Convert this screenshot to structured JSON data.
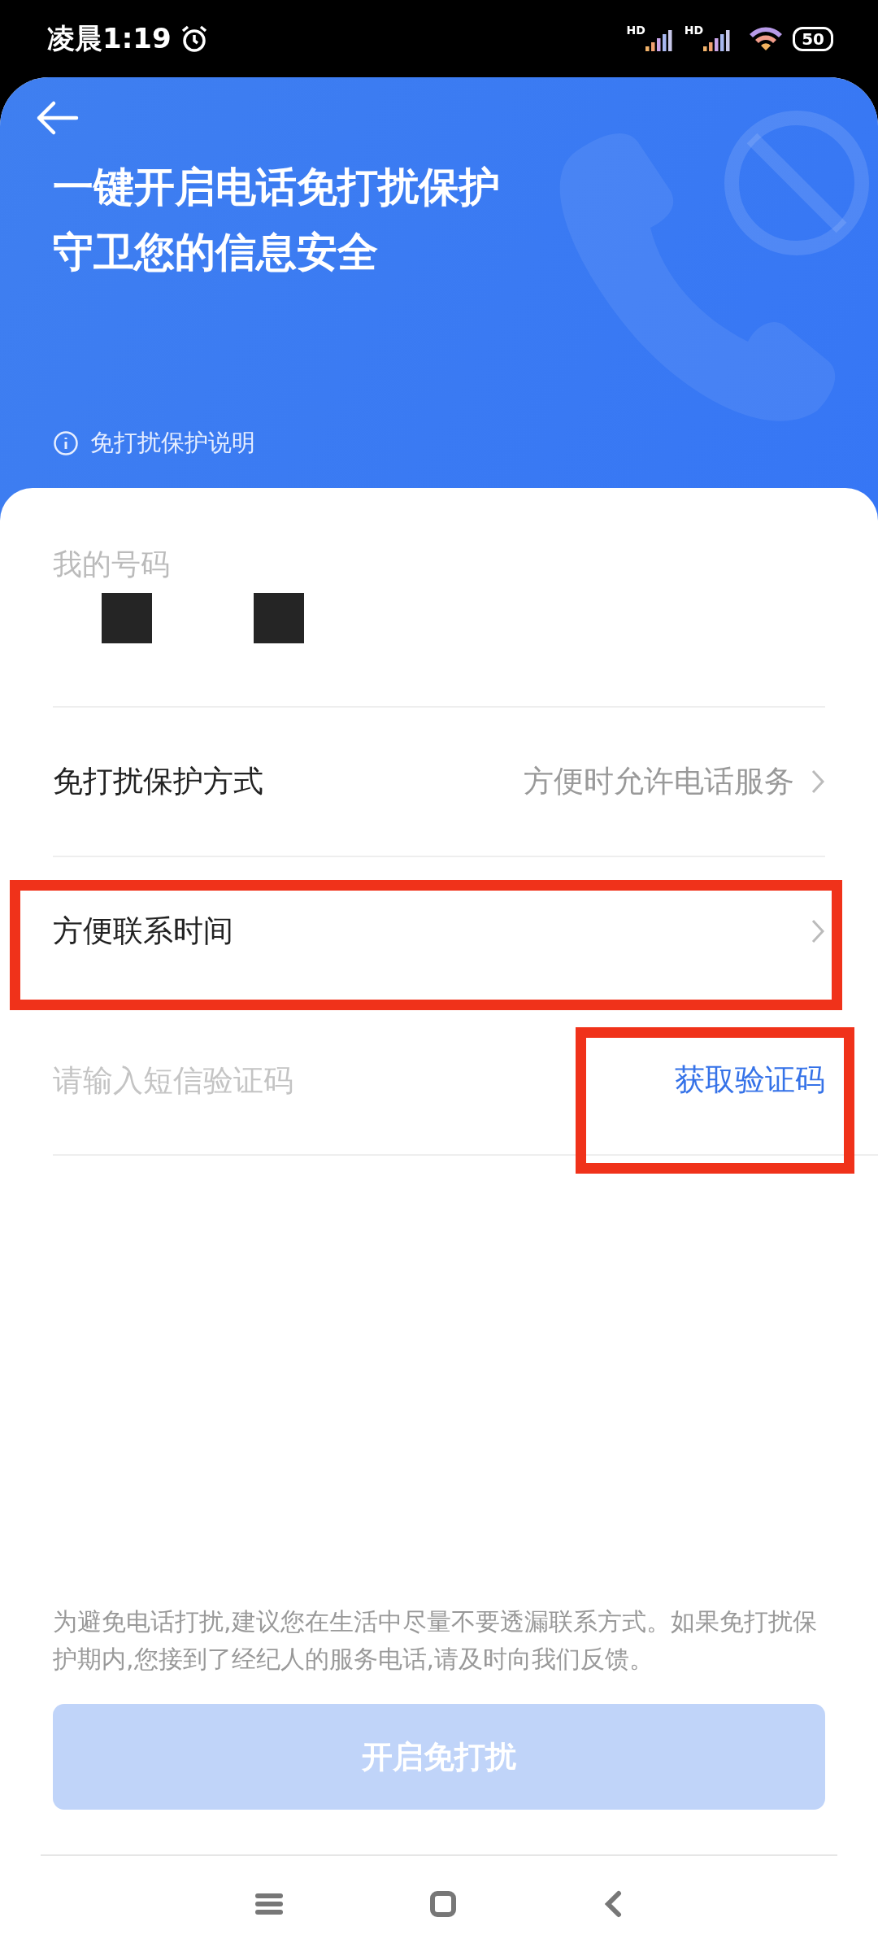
{
  "status_bar": {
    "time": "凌晨1:19",
    "signals": [
      "HD",
      "HD"
    ],
    "battery": "50"
  },
  "header": {
    "title_lines": [
      "一键开启电话免打扰保护",
      "守卫您的信息安全"
    ],
    "info_link": "免打扰保护说明"
  },
  "phone_field": {
    "label": "我的号码"
  },
  "rows": [
    {
      "kind": "select",
      "label": "免打扰保护方式",
      "value": "方便时允许电话服务",
      "highlighted": false
    },
    {
      "kind": "select",
      "label": "方便联系时间",
      "highlighted": true
    },
    {
      "kind": "code",
      "placeholder": "请输入短信验证码",
      "action": "获取验证码",
      "highlighted": true
    }
  ],
  "notice": "为避免电话打扰,建议您在生活中尽量不要透漏联系方式。如果免打扰保护期内,您接到了经纪人的服务电话,请及时向我们反馈。",
  "submit": {
    "label": "开启免打扰",
    "disabled": true
  }
}
